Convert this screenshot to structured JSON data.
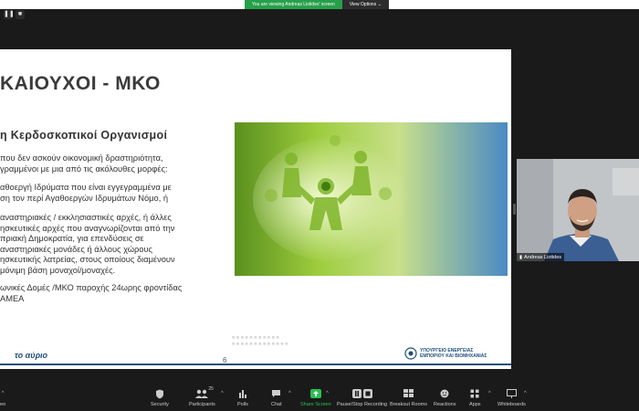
{
  "share_banner": {
    "message": "You are viewing Andreas Liotides' screen",
    "options_label": "View Options"
  },
  "slide": {
    "title": "ΚΑΙΟΥΧΟΙ - ΜΚΟ",
    "subtitle": "η Κερδοσκοπικοί Οργανισμοί",
    "paragraphs": [
      [
        "που δεν ασκούν οικονομική δραστηριότητα,",
        "γραμμένοι με μια από τις ακόλουθες μορφές:"
      ],
      [
        "αθοεργή Ιδρύματα που είναι εγγεγραμμένα με",
        "ση τον περί Αγαθοεργών Ιδρυμάτων Νόμο, ή"
      ],
      [
        "αναστηριακές / εκκλησιαστικές αρχές, ή άλλες",
        "ησκευτικές αρχές που αναγνωρίζονται από την",
        "πριακή Δημοκρατία, για επενδύσεις σε",
        "αναστηριακές μονάδες ή άλλους χώρους",
        "ησκευτικής λατρείας, στους οποίους διαμένουν",
        "μόνιμη βάση μοναχοί/μοναχές."
      ],
      [
        "ωνικές Δομές /ΜΚΟ παροχής 24ωρης φροντίδας",
        "ΑΜΕΑ"
      ]
    ],
    "page_number": "6",
    "footer_left": "το αύριο",
    "footer_logo_lines": [
      "ΥΠΟΥΡΓΕΙΟ ΕΝΕΡΓΕΙΑΣ",
      "ΕΜΠΟΡΙΟΥ ΚΑΙ ΒΙΟΜΗΧΑΝΙΑΣ"
    ]
  },
  "participant": {
    "name": "Andreas Liotides"
  },
  "toolbar": {
    "participants_count": "25",
    "items": [
      {
        "label": "Security",
        "icon": "shield-icon"
      },
      {
        "label": "Participants",
        "icon": "participants-icon"
      },
      {
        "label": "Polls",
        "icon": "polls-icon"
      },
      {
        "label": "Chat",
        "icon": "chat-icon"
      },
      {
        "label": "Share Screen",
        "icon": "share-screen-icon"
      },
      {
        "label": "Pause/Stop Recording",
        "icon": "recording-icon"
      },
      {
        "label": "Breakout Rooms",
        "icon": "breakout-rooms-icon"
      },
      {
        "label": "Reactions",
        "icon": "reactions-icon"
      },
      {
        "label": "Apps",
        "icon": "apps-icon"
      },
      {
        "label": "Whiteboards",
        "icon": "whiteboard-icon"
      }
    ],
    "left_fragment": "eo"
  },
  "colors": {
    "share_green": "#27a04a",
    "slide_blue": "#1f4e79",
    "toolbar_bg": "#1a1a1a"
  }
}
